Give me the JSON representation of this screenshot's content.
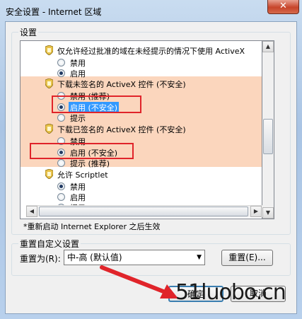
{
  "window": {
    "title": "安全设置 - Internet 区域",
    "close_label": "✕"
  },
  "settings": {
    "group_label": "设置",
    "rows": [
      {
        "kind": "header",
        "text": "仅允许经过批准的域在未经提示的情况下使用 ActiveX",
        "icon": "shield-icon"
      },
      {
        "kind": "option",
        "text": "禁用",
        "checked": false
      },
      {
        "kind": "option",
        "text": "启用",
        "checked": true
      },
      {
        "kind": "header",
        "text": "下载未签名的 ActiveX 控件 (不安全)",
        "icon": "shield-icon"
      },
      {
        "kind": "option",
        "text": "禁用 (推荐)",
        "checked": false
      },
      {
        "kind": "option",
        "text": "启用 (不安全)",
        "checked": true
      },
      {
        "kind": "option",
        "text": "提示",
        "checked": false
      },
      {
        "kind": "header",
        "text": "下载已签名的 ActiveX 控件 (不安全)",
        "icon": "shield-icon"
      },
      {
        "kind": "option",
        "text": "禁用",
        "checked": false
      },
      {
        "kind": "option",
        "text": "启用 (不安全)",
        "checked": true
      },
      {
        "kind": "option",
        "text": "提示 (推荐)",
        "checked": false
      },
      {
        "kind": "header",
        "text": "允许 Scriptlet",
        "icon": "shield-icon"
      },
      {
        "kind": "option",
        "text": "禁用",
        "checked": true
      },
      {
        "kind": "option",
        "text": "启用",
        "checked": false
      },
      {
        "kind": "option",
        "text": "提示",
        "checked": false
      }
    ],
    "note": "*重新启动 Internet Explorer 之后生效"
  },
  "reset": {
    "group_label": "重置自定义设置",
    "reset_to_label": "重置为(R):",
    "combo_value": "中-高 (默认值)",
    "reset_button": "重置(E)..."
  },
  "buttons": {
    "ok": "确定",
    "cancel": "取消"
  },
  "watermark": "51luobo.cn",
  "colors": {
    "highlight": "#fbd6bd",
    "redbox": "#e0242a",
    "arrow": "#e0242a"
  }
}
